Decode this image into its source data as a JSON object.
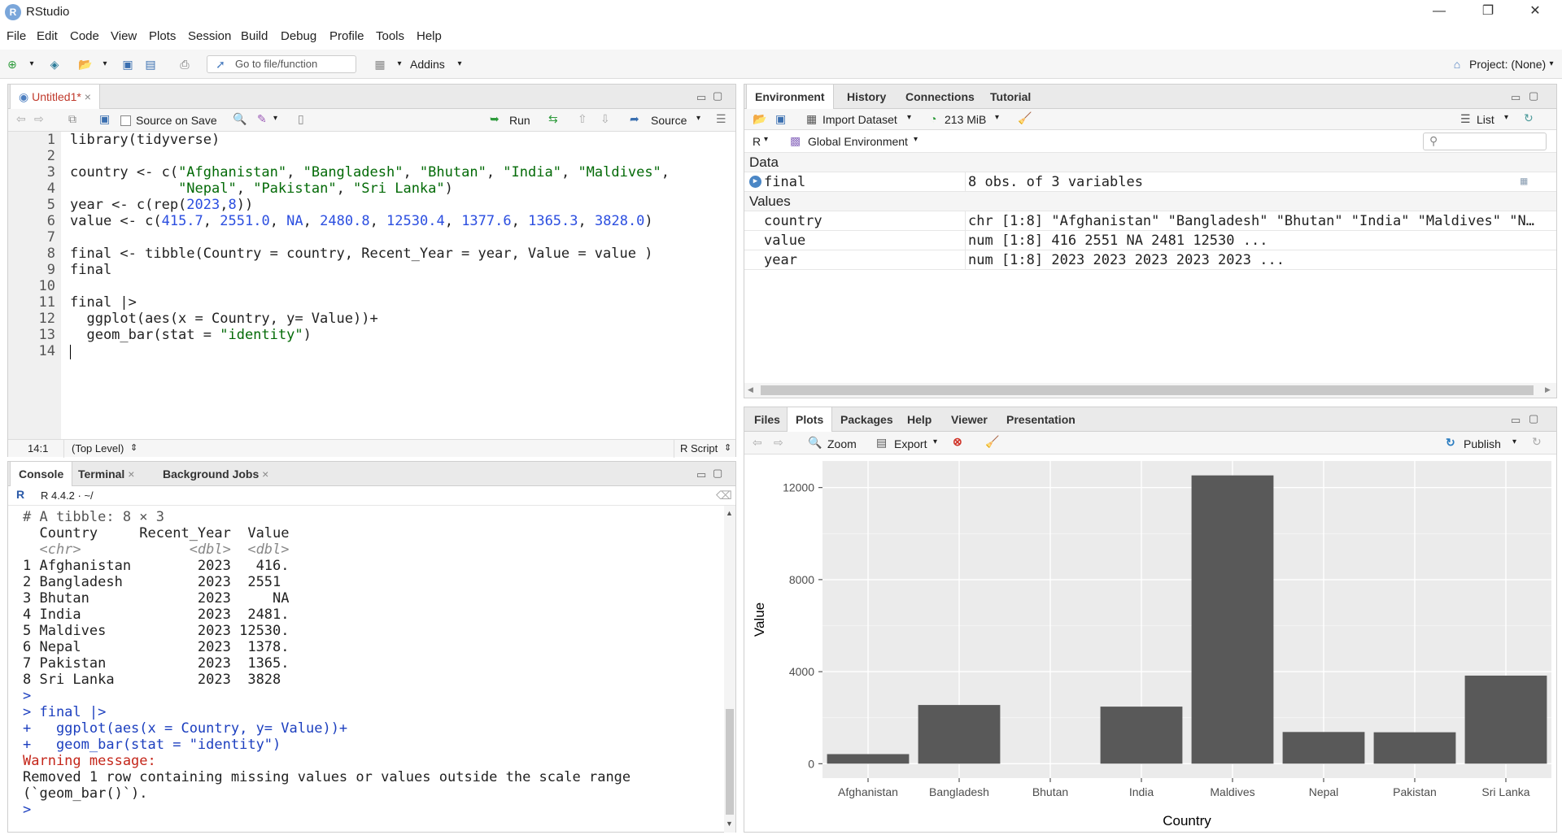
{
  "window": {
    "title": "RStudio",
    "minimize": "—",
    "restore": "❐",
    "close": "✕"
  },
  "menu": [
    "File",
    "Edit",
    "Code",
    "View",
    "Plots",
    "Session",
    "Build",
    "Debug",
    "Profile",
    "Tools",
    "Help"
  ],
  "toolbar": {
    "goto_placeholder": "Go to file/function",
    "addins": "Addins",
    "project": "Project: (None)"
  },
  "editor": {
    "tab": "Untitled1*",
    "source_on_save": "Source on Save",
    "run": "Run",
    "source": "Source",
    "status_pos": "14:1",
    "status_level": "(Top Level)",
    "status_type": "R Script",
    "line_numbers": [
      "1",
      "2",
      "3",
      "4",
      "5",
      "6",
      "7",
      "8",
      "9",
      "10",
      "11",
      "12",
      "13",
      "14"
    ]
  },
  "console": {
    "tabs": [
      "Console",
      "Terminal",
      "Background Jobs"
    ],
    "version": "R 4.4.2 · ~/",
    "lines": [
      "# A tibble: 8 × 3",
      "  Country     Recent_Year  Value",
      "  <chr>             <dbl>  <dbl>",
      "1 Afghanistan        2023   416.",
      "2 Bangladesh         2023  2551",
      "3 Bhutan             2023     NA",
      "4 India              2023  2481.",
      "5 Maldives           2023 12530.",
      "6 Nepal              2023  1378.",
      "7 Pakistan           2023  1365.",
      "8 Sri Lanka          2023  3828",
      ">",
      "> final |>",
      "+   ggplot(aes(x = Country, y= Value))+",
      "+   geom_bar(stat = \"identity\")",
      "Warning message:",
      "Removed 1 row containing missing values or values outside the scale range",
      "(`geom_bar()`).",
      ">"
    ]
  },
  "environment": {
    "tabs": [
      "Environment",
      "History",
      "Connections",
      "Tutorial"
    ],
    "import": "Import Dataset",
    "memory": "213 MiB",
    "list": "List",
    "lang": "R",
    "scope": "Global Environment",
    "data_header": "Data",
    "values_header": "Values",
    "data": [
      {
        "name": "final",
        "value": "8 obs. of 3 variables"
      }
    ],
    "values": [
      {
        "name": "country",
        "value": "chr [1:8] \"Afghanistan\" \"Bangladesh\" \"Bhutan\" \"India\" \"Maldives\" \"N…"
      },
      {
        "name": "value",
        "value": "num [1:8] 416 2551 NA 2481 12530 ..."
      },
      {
        "name": "year",
        "value": "num [1:8] 2023 2023 2023 2023 2023 ..."
      }
    ]
  },
  "files": {
    "tabs": [
      "Files",
      "Plots",
      "Packages",
      "Help",
      "Viewer",
      "Presentation"
    ],
    "zoom": "Zoom",
    "export": "Export",
    "publish": "Publish"
  },
  "chart_data": {
    "type": "bar",
    "categories": [
      "Afghanistan",
      "Bangladesh",
      "Bhutan",
      "India",
      "Maldives",
      "Nepal",
      "Pakistan",
      "Sri Lanka"
    ],
    "values": [
      415.7,
      2551.0,
      null,
      2480.8,
      12530.4,
      1377.6,
      1365.3,
      3828.0
    ],
    "xlabel": "Country",
    "ylabel": "Value",
    "yticks": [
      "0",
      "4000",
      "8000",
      "12000"
    ],
    "ylim": [
      -626,
      13156
    ],
    "grid": true
  }
}
